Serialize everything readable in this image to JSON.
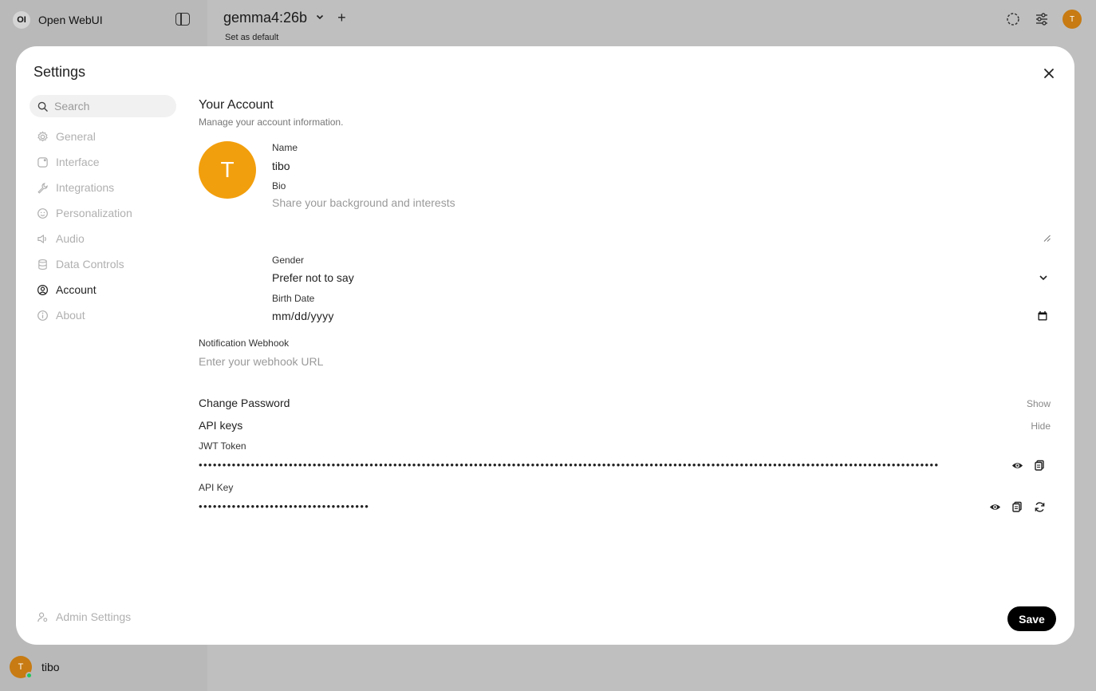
{
  "app": {
    "logo_text": "OI",
    "name": "Open WebUI",
    "model": "gemma4:26b",
    "set_default": "Set as default",
    "user_initial": "T",
    "user_name": "tibo"
  },
  "settings": {
    "title": "Settings",
    "search_placeholder": "Search",
    "nav": [
      {
        "label": "General",
        "icon": "gear-icon"
      },
      {
        "label": "Interface",
        "icon": "interface-icon"
      },
      {
        "label": "Integrations",
        "icon": "wrench-icon"
      },
      {
        "label": "Personalization",
        "icon": "face-icon"
      },
      {
        "label": "Audio",
        "icon": "speaker-icon"
      },
      {
        "label": "Data Controls",
        "icon": "database-icon"
      },
      {
        "label": "Account",
        "icon": "user-circle-icon",
        "active": true
      },
      {
        "label": "About",
        "icon": "info-icon"
      }
    ],
    "admin_label": "Admin Settings",
    "save_label": "Save"
  },
  "account": {
    "title": "Your Account",
    "subtitle": "Manage your account information.",
    "avatar_initial": "T",
    "avatar_color": "#f29f0d",
    "name_label": "Name",
    "name_value": "tibo",
    "bio_label": "Bio",
    "bio_placeholder": "Share your background and interests",
    "gender_label": "Gender",
    "gender_value": "Prefer not to say",
    "birth_label": "Birth Date",
    "birth_value": "mm/dd/yyyy",
    "webhook_label": "Notification Webhook",
    "webhook_placeholder": "Enter your webhook URL",
    "change_password_label": "Change Password",
    "change_password_action": "Show",
    "api_keys_label": "API keys",
    "api_keys_action": "Hide",
    "jwt_label": "JWT Token",
    "jwt_masked": "••••••••••••••••••••••••••••••••••••••••••••••••••••••••••••••••••••••••••••••••••••••••••••••••••••••••••••••••••••••••••••••••••••••••••••••••••••••••••••",
    "api_key_label": "API Key",
    "api_key_masked": "••••••••••••••••••••••••••••••••••••"
  }
}
